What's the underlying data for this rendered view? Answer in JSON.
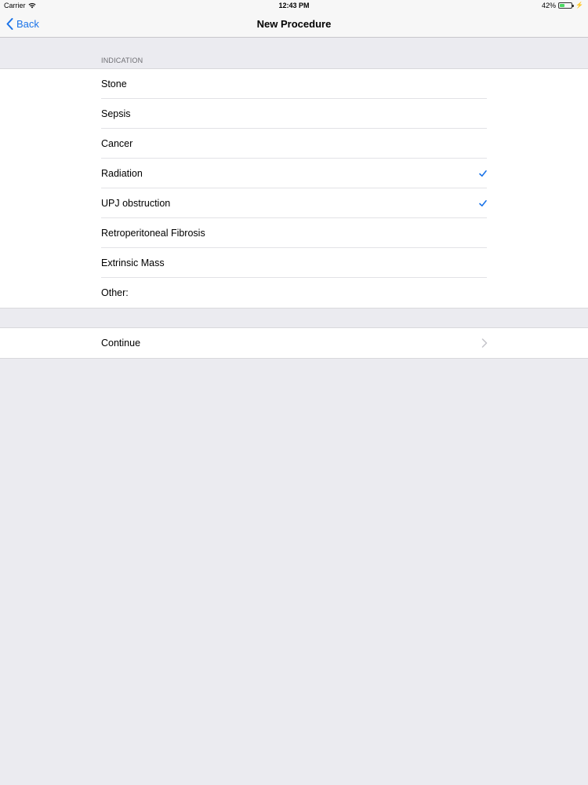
{
  "status_bar": {
    "carrier": "Carrier",
    "time": "12:43 PM",
    "battery": "42%",
    "battery_level": 0.42,
    "wifi_icon": "wifi-icon",
    "charging_icon": "bolt-icon"
  },
  "nav_bar": {
    "back_label": "Back",
    "title": "New Procedure"
  },
  "indication": {
    "header": "INDICATION",
    "items": [
      {
        "label": "Stone",
        "checked": false
      },
      {
        "label": "Sepsis",
        "checked": false
      },
      {
        "label": "Cancer",
        "checked": false
      },
      {
        "label": "Radiation",
        "checked": true
      },
      {
        "label": "UPJ obstruction",
        "checked": true
      },
      {
        "label": "Retroperitoneal Fibrosis",
        "checked": false
      },
      {
        "label": "Extrinsic Mass",
        "checked": false
      },
      {
        "label": "Other:",
        "checked": false
      }
    ]
  },
  "continue_row": {
    "label": "Continue"
  },
  "colors": {
    "accent": "#1a73e8",
    "background": "#ebebf0",
    "cell_background": "#ffffff",
    "separator": "#e2e2e6",
    "battery_green": "#4cd964"
  }
}
